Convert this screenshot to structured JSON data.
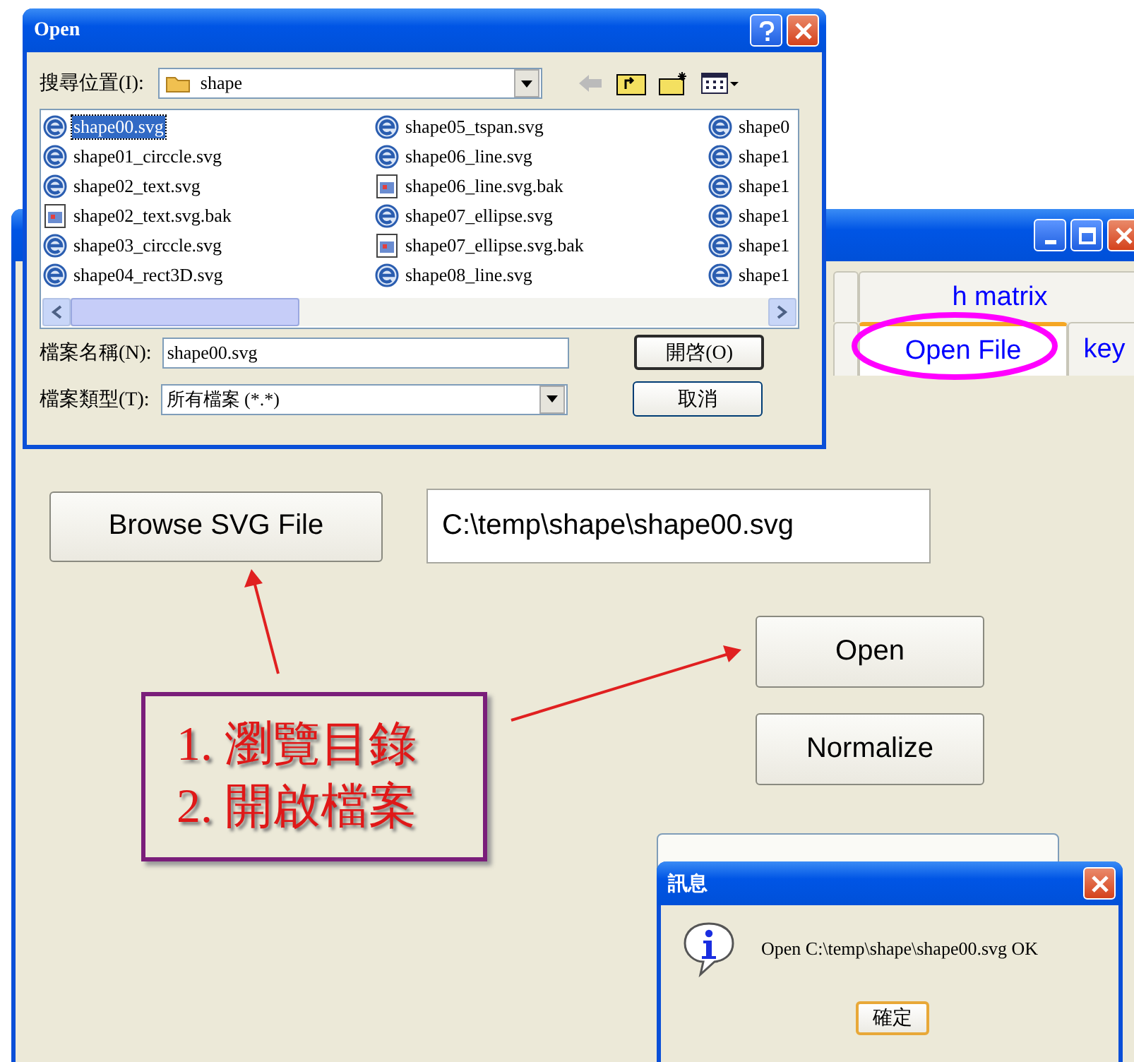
{
  "main_window": {
    "tab_rows": [
      [
        {
          "label": "h matrix",
          "selected": false
        }
      ],
      [
        {
          "label": "Open File",
          "selected": true
        },
        {
          "label": "key",
          "selected": false
        }
      ]
    ],
    "browse_button": "Browse SVG File",
    "path_field": {
      "value": "C:\\temp\\shape\\shape00.svg"
    },
    "buttons": [
      "Open",
      "Normalize"
    ]
  },
  "annotation": {
    "lines": [
      "1. 瀏覽目錄",
      "2. 開啟檔案"
    ]
  },
  "open_dialog": {
    "title": "Open",
    "look_in_label": "搜尋位置(I):",
    "look_in_value": "shape",
    "files": [
      {
        "name": "shape00.svg",
        "kind": "svg",
        "selected": true
      },
      {
        "name": "shape01_circcle.svg",
        "kind": "svg",
        "selected": false
      },
      {
        "name": "shape02_text.svg",
        "kind": "svg",
        "selected": false
      },
      {
        "name": "shape02_text.svg.bak",
        "kind": "bak",
        "selected": false
      },
      {
        "name": "shape03_circcle.svg",
        "kind": "svg",
        "selected": false
      },
      {
        "name": "shape04_rect3D.svg",
        "kind": "svg",
        "selected": false
      },
      {
        "name": "shape05_tspan.svg",
        "kind": "svg",
        "selected": false
      },
      {
        "name": "shape06_line.svg",
        "kind": "svg",
        "selected": false
      },
      {
        "name": "shape06_line.svg.bak",
        "kind": "bak",
        "selected": false
      },
      {
        "name": "shape07_ellipse.svg",
        "kind": "svg",
        "selected": false
      },
      {
        "name": "shape07_ellipse.svg.bak",
        "kind": "bak",
        "selected": false
      },
      {
        "name": "shape08_line.svg",
        "kind": "svg",
        "selected": false
      },
      {
        "name": "shape0",
        "kind": "svg",
        "selected": false
      },
      {
        "name": "shape1",
        "kind": "svg",
        "selected": false
      },
      {
        "name": "shape1",
        "kind": "svg",
        "selected": false
      },
      {
        "name": "shape1",
        "kind": "svg",
        "selected": false
      },
      {
        "name": "shape1",
        "kind": "svg",
        "selected": false
      },
      {
        "name": "shape1",
        "kind": "svg",
        "selected": false
      }
    ],
    "file_name_label": "檔案名稱(N):",
    "file_name_value": "shape00.svg",
    "file_type_label": "檔案類型(T):",
    "file_type_value": "所有檔案 (*.*)",
    "buttons": [
      "開啓(O)",
      "取消"
    ]
  },
  "message_dialog": {
    "title": "訊息",
    "message": "Open C:\\temp\\shape\\shape00.svg OK",
    "button": "確定"
  }
}
